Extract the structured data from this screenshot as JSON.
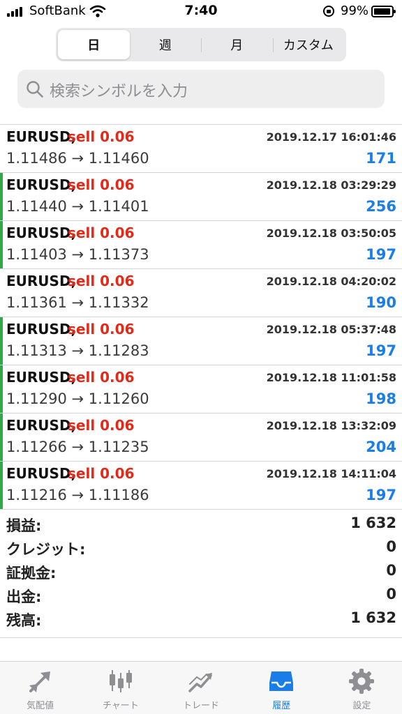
{
  "status_bar": {
    "carrier": "SoftBank",
    "time": "7:40",
    "battery": "99%"
  },
  "period_tabs": [
    {
      "label": "日",
      "active": true
    },
    {
      "label": "週",
      "active": false
    },
    {
      "label": "月",
      "active": false
    },
    {
      "label": "カスタム",
      "active": false
    }
  ],
  "search": {
    "placeholder": "検索シンボルを入力"
  },
  "deals": [
    {
      "symbol": "EURUSD,",
      "type": "sell 0.06",
      "time": "2019.12.17 16:01:46",
      "prices": "1.11486 → 1.11460",
      "profit": "171",
      "marked": false
    },
    {
      "symbol": "EURUSD,",
      "type": "sell 0.06",
      "time": "2019.12.18 03:29:29",
      "prices": "1.11440 → 1.11401",
      "profit": "256",
      "marked": true
    },
    {
      "symbol": "EURUSD,",
      "type": "sell 0.06",
      "time": "2019.12.18 03:50:05",
      "prices": "1.11403 → 1.11373",
      "profit": "197",
      "marked": true
    },
    {
      "symbol": "EURUSD,",
      "type": "sell 0.06",
      "time": "2019.12.18 04:20:02",
      "prices": "1.11361 → 1.11332",
      "profit": "190",
      "marked": false
    },
    {
      "symbol": "EURUSD,",
      "type": "sell 0.06",
      "time": "2019.12.18 05:37:48",
      "prices": "1.11313 → 1.11283",
      "profit": "197",
      "marked": true
    },
    {
      "symbol": "EURUSD,",
      "type": "sell 0.06",
      "time": "2019.12.18 11:01:58",
      "prices": "1.11290 → 1.11260",
      "profit": "198",
      "marked": true
    },
    {
      "symbol": "EURUSD,",
      "type": "sell 0.06",
      "time": "2019.12.18 13:32:09",
      "prices": "1.11266 → 1.11235",
      "profit": "204",
      "marked": true
    },
    {
      "symbol": "EURUSD,",
      "type": "sell 0.06",
      "time": "2019.12.18 14:11:04",
      "prices": "1.11216 → 1.11186",
      "profit": "197",
      "marked": true
    }
  ],
  "summary": [
    {
      "label": "損益:",
      "value": "1 632"
    },
    {
      "label": "クレジット:",
      "value": "0"
    },
    {
      "label": "証拠金:",
      "value": "0"
    },
    {
      "label": "出金:",
      "value": "0"
    },
    {
      "label": "残高:",
      "value": "1 632"
    }
  ],
  "tabbar": [
    {
      "label": "気配値",
      "icon": "quotes-icon",
      "active": false
    },
    {
      "label": "チャート",
      "icon": "chart-icon",
      "active": false
    },
    {
      "label": "トレード",
      "icon": "trade-icon",
      "active": false
    },
    {
      "label": "履歴",
      "icon": "history-icon",
      "active": true
    },
    {
      "label": "設定",
      "icon": "settings-icon",
      "active": false
    }
  ],
  "colors": {
    "sell": "#e02a1a",
    "profit": "#1a7de8",
    "marker": "#30a84a",
    "active_tab": "#1a7de8",
    "inactive_tab": "#8e8e93"
  }
}
